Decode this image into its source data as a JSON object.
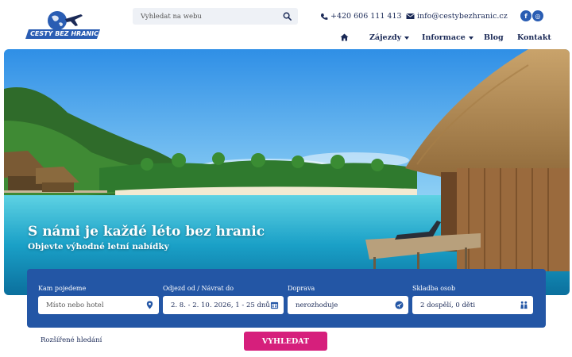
{
  "header": {
    "logo_text": "CESTY BEZ HRANIC",
    "search": {
      "placeholder": "Vyhledat na webu",
      "icon": "search-icon"
    },
    "phone": "+420 606 111 413",
    "email": "info@cestybezhranic.cz",
    "social": [
      {
        "name": "facebook",
        "glyph": "f"
      },
      {
        "name": "instagram",
        "glyph": "◎"
      }
    ]
  },
  "nav": {
    "home_icon": "home-icon",
    "items": [
      {
        "label": "Zájezdy",
        "dropdown": true
      },
      {
        "label": "Informace",
        "dropdown": true
      },
      {
        "label": "Blog",
        "dropdown": false
      },
      {
        "label": "Kontakt",
        "dropdown": false
      }
    ]
  },
  "hero": {
    "title": "S námi je každé léto bez hranic",
    "subtitle": "Objevte výhodné letní nabídky"
  },
  "search_form": {
    "fields": [
      {
        "label": "Kam pojedeme",
        "value": "",
        "placeholder": "Místo nebo hotel",
        "icon": "map-pin-icon"
      },
      {
        "label": "Odjezd od / Návrat do",
        "value": "2. 8. - 2. 10. 2026, 1 - 25 dnů",
        "icon": "calendar-icon"
      },
      {
        "label": "Doprava",
        "value": "nerozhoduje",
        "icon": "plane-icon"
      },
      {
        "label": "Skladba osob",
        "value": "2 dospělí, 0 děti",
        "icon": "people-icon"
      }
    ],
    "advanced_label": "Rozšířené hledání",
    "submit_label": "VYHLEDAT"
  },
  "colors": {
    "brand_blue": "#2356a5",
    "navy_text": "#1b2a57",
    "button_pink": "#d61f7c"
  }
}
